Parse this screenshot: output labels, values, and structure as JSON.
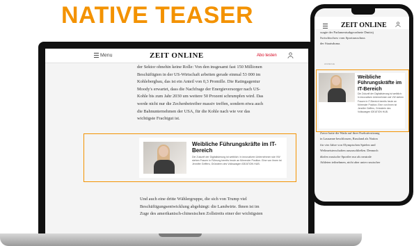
{
  "headline": "NATIVE TEASER",
  "desktop": {
    "header": {
      "menu_label": "Menu",
      "logo": "ZEIT ONLINE",
      "abo_label": "Abo testen"
    },
    "article_top": [
      "der Sektor ohnehin keine Rolle: Von den insgesamt fast 150 Millionen",
      "Beschäftigten in der US-Wirtschaft arbeiten gerade einmal 53 000 im",
      "Kohlebergbau, das ist ein Anteil von 0,3 Promille. Die Ratingagentur",
      "Moody's erwartet, dass die Nachfrage der Energieversorger nach US-",
      "Kohle bis zum Jahr 2030 um weitere 50 Prozent schrumpfen wird. Das",
      "werde nicht nur die Zechenbetreiber massiv treffen, sondern etwa auch",
      "die Bahnunternehmen der USA, für die Kohle nach wie vor das",
      "wichtigste Frachtgut ist."
    ],
    "teaser": {
      "title": "Weibliche Führungskräfte im IT-Bereich",
      "text": "Die Zukunft der Digitalisierung ist weiblich: In innovativen Unternehmen wie VW stehen Frauen in Führung bereits heute an führender Position. Eine von ihnen ist Jennifer Geffers, Gründerin des Volkswagen IDEATION HUB."
    },
    "article_bottom": [
      "Und auch eine dritte Wählergruppe, die sich von Trump viel",
      "Beschäftigungsentwicklung abgehängt: die Landwirte. Ihnen ist im",
      "Zuge des amerikanisch-chinesischen Zollstreits einer der wichtigsten"
    ]
  },
  "mobile": {
    "logo": "ZEIT ONLINE",
    "article_top": [
      "ssagte der Parlamentsabgeordnete Dmitrij",
      "Swischtschow vom Sportausschuss",
      "der Staatsduma."
    ],
    "label": "ANZEIGE",
    "teaser": {
      "title": "Weibliche Führungskräfte im IT-Bereich",
      "text": "Die Zukunft der Digitalisierung ist weiblich: In innovativen Unternehmen wie VW stehen Frauen in IT-Bereich bereits heute an führender Position. Eine von ihnen ist Jennifer Geffers, Gründerin des Volkswagen IDEATION HUB."
    },
    "article_bottom": [
      "Zuvor hatte die Wada auf ihrer Exekutivsitzung",
      "in Lausanne beschlossen, Russland als Nation",
      "für vier Jahre von Olympischen Spielen und",
      "Weltmeisterschaften auszuschließen. Dennoch",
      "dürfen russische Sportler nur als neutrale",
      "Athleten teilnehmen, nicht aber unter russischer"
    ]
  },
  "colors": {
    "accent": "#f39200",
    "abo": "#d6001c"
  },
  "icons": [
    "menu-icon",
    "user-icon"
  ]
}
